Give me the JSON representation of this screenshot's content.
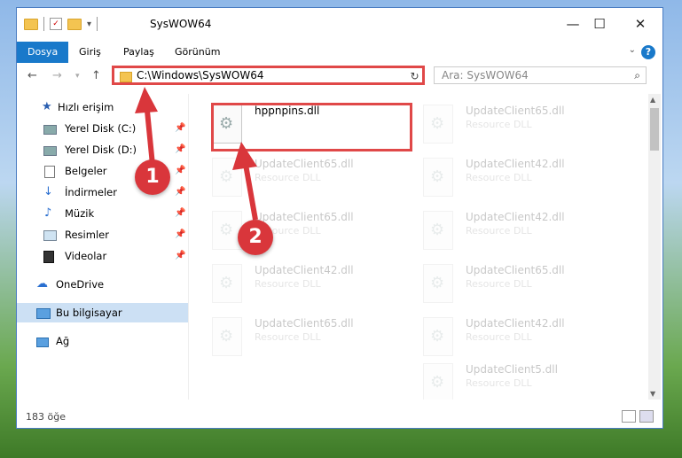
{
  "window": {
    "title": "SysWOW64"
  },
  "window_controls": {
    "minimize": "—",
    "maximize": "☐",
    "close": "✕"
  },
  "menu": [
    "Dosya",
    "Giriş",
    "Paylaş",
    "Görünüm"
  ],
  "address": {
    "path": "C:\\Windows\\SysWOW64",
    "refresh": "↻"
  },
  "search": {
    "placeholder": "Ara: SysWOW64"
  },
  "sidebar": {
    "items": [
      {
        "label": "Hızlı erişim",
        "pinned": false
      },
      {
        "label": "Yerel Disk (C:)",
        "pinned": true
      },
      {
        "label": "Yerel Disk (D:)",
        "pinned": true
      },
      {
        "label": "Belgeler",
        "pinned": true
      },
      {
        "label": "İndirmeler",
        "pinned": true
      },
      {
        "label": "Müzik",
        "pinned": true
      },
      {
        "label": "Resimler",
        "pinned": true
      },
      {
        "label": "Videolar",
        "pinned": true
      },
      {
        "label": "OneDrive",
        "pinned": false
      },
      {
        "label": "Bu bilgisayar",
        "pinned": false
      },
      {
        "label": "Ağ",
        "pinned": false
      }
    ]
  },
  "files": {
    "main": {
      "name": "hppnpins.dll"
    },
    "ghost": [
      {
        "name": "UpdateClient65.dll",
        "type": "Resource DLL"
      },
      {
        "name": "UpdateClient65.dll",
        "type": "Resource DLL"
      },
      {
        "name": "UpdateClient42.dll",
        "type": "Resource DLL"
      },
      {
        "name": "UpdateClient65.dll",
        "type": "Resource DLL"
      },
      {
        "name": "UpdateClient42.dll",
        "type": "Resource DLL"
      },
      {
        "name": "UpdateClient42.dll",
        "type": "Resource DLL"
      },
      {
        "name": "UpdateClient65.dll",
        "type": "Resource DLL"
      },
      {
        "name": "UpdateClient65.dll",
        "type": "Resource DLL"
      },
      {
        "name": "UpdateClient42.dll",
        "type": "Resource DLL"
      },
      {
        "name": "UpdateClient5.dll",
        "type": "Resource DLL"
      }
    ]
  },
  "status": {
    "count": "183 öğe"
  },
  "annotations": {
    "badge1": "1",
    "badge2": "2",
    "color": "#d9363b"
  }
}
